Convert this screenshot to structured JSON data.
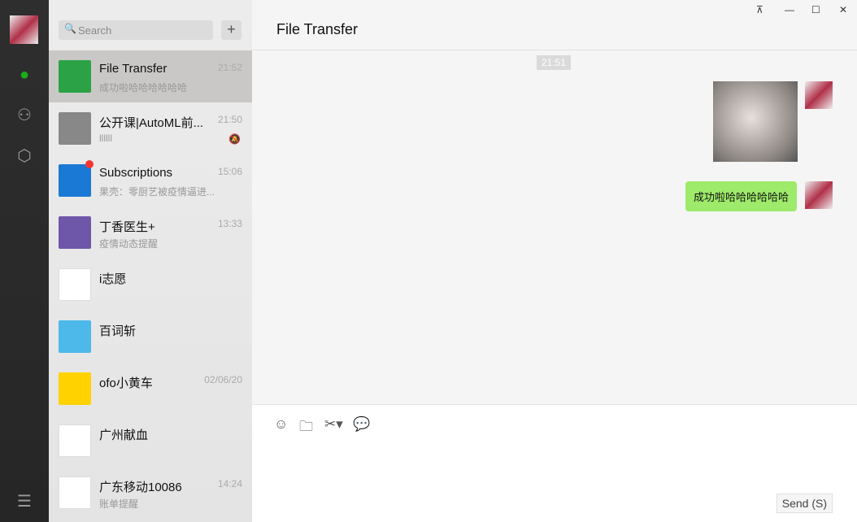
{
  "sidebar": {
    "icons": [
      "avatar",
      "chat-icon",
      "contacts-icon",
      "box-icon",
      "menu-icon"
    ],
    "accent": "#1aad19"
  },
  "search": {
    "placeholder": "Search"
  },
  "chats": [
    {
      "name": "File Transfer",
      "preview": "成功啦哈哈哈哈哈哈",
      "time": "21:52",
      "color": "#2ba245",
      "selected": true
    },
    {
      "name": "公开课|AutoML前...",
      "preview": "llllll",
      "time": "21:50",
      "color": "#888",
      "muted": true
    },
    {
      "name": "Subscriptions",
      "preview": "果壳：零厨艺被疫情逼进...",
      "time": "15:06",
      "color": "#1b79d6",
      "badge": true
    },
    {
      "name": "丁香医生+",
      "preview": "疫情动态提醒",
      "time": "13:33",
      "color": "#6e57a9"
    },
    {
      "name": "i志愿",
      "preview": "",
      "time": "",
      "color": "#fff"
    },
    {
      "name": "百词斩",
      "preview": "",
      "time": "",
      "color": "#4db8ea"
    },
    {
      "name": "ofo小黄车",
      "preview": "",
      "time": "02/06/20",
      "color": "#ffd200"
    },
    {
      "name": "广州献血",
      "preview": "",
      "time": "",
      "color": "#fff"
    },
    {
      "name": "广东移动10086",
      "preview": "账单提醒",
      "time": "14:24",
      "color": "#fff"
    }
  ],
  "main": {
    "title": "File Transfer",
    "timestamp": "21:51",
    "message": "成功啦哈哈哈哈哈哈",
    "send_label": "Send (S)"
  }
}
